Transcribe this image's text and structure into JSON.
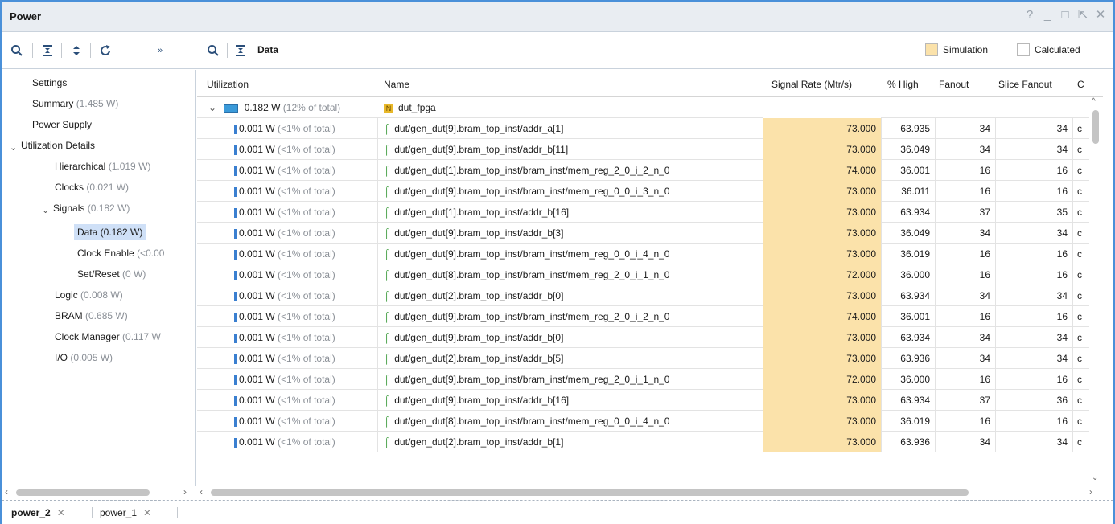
{
  "window": {
    "title": "Power",
    "controls": [
      "?",
      "_",
      "□",
      "⇱",
      "✕"
    ]
  },
  "toolbar": {
    "section_label": "Data",
    "legend": [
      {
        "label": "Simulation",
        "color": "#fbe2aa"
      },
      {
        "label": "Calculated",
        "color": "#ffffff"
      }
    ]
  },
  "tree": [
    {
      "label": "Settings",
      "value": ""
    },
    {
      "label": "Summary",
      "value": "(1.485 W)"
    },
    {
      "label": "Power Supply",
      "value": ""
    },
    {
      "label": "Utilization Details",
      "value": ""
    },
    {
      "label": "Hierarchical",
      "value": "(1.019 W)"
    },
    {
      "label": "Clocks",
      "value": "(0.021 W)"
    },
    {
      "label": "Signals",
      "value": "(0.182 W)"
    },
    {
      "label": "Data (0.182 W)",
      "value": ""
    },
    {
      "label": "Clock Enable",
      "value": "(<0.00"
    },
    {
      "label": "Set/Reset",
      "value": "(0 W)"
    },
    {
      "label": "Logic",
      "value": "(0.008 W)"
    },
    {
      "label": "BRAM",
      "value": "(0.685 W)"
    },
    {
      "label": "Clock Manager",
      "value": "(0.117 W"
    },
    {
      "label": "I/O",
      "value": "(0.005 W)"
    }
  ],
  "columns": [
    "Utilization",
    "Name",
    "Signal Rate (Mtr/s)",
    "% High",
    "Fanout",
    "Slice Fanout",
    "C"
  ],
  "top_row": {
    "util_value": "0.182 W",
    "util_note": "(12% of total)",
    "name": "dut_fpga"
  },
  "rows": [
    {
      "w": "0.001 W",
      "pct": "(<1% of total)",
      "name": "dut/gen_dut[9].bram_top_inst/addr_a[1]",
      "rate": "73.000",
      "high": "63.935",
      "fanout": "34",
      "slice": "34",
      "c": "c"
    },
    {
      "w": "0.001 W",
      "pct": "(<1% of total)",
      "name": "dut/gen_dut[9].bram_top_inst/addr_b[11]",
      "rate": "73.000",
      "high": "36.049",
      "fanout": "34",
      "slice": "34",
      "c": "c"
    },
    {
      "w": "0.001 W",
      "pct": "(<1% of total)",
      "name": "dut/gen_dut[1].bram_top_inst/bram_inst/mem_reg_2_0_i_2_n_0",
      "rate": "74.000",
      "high": "36.001",
      "fanout": "16",
      "slice": "16",
      "c": "c"
    },
    {
      "w": "0.001 W",
      "pct": "(<1% of total)",
      "name": "dut/gen_dut[9].bram_top_inst/bram_inst/mem_reg_0_0_i_3_n_0",
      "rate": "73.000",
      "high": "36.011",
      "fanout": "16",
      "slice": "16",
      "c": "c"
    },
    {
      "w": "0.001 W",
      "pct": "(<1% of total)",
      "name": "dut/gen_dut[1].bram_top_inst/addr_b[16]",
      "rate": "73.000",
      "high": "63.934",
      "fanout": "37",
      "slice": "35",
      "c": "c"
    },
    {
      "w": "0.001 W",
      "pct": "(<1% of total)",
      "name": "dut/gen_dut[9].bram_top_inst/addr_b[3]",
      "rate": "73.000",
      "high": "36.049",
      "fanout": "34",
      "slice": "34",
      "c": "c"
    },
    {
      "w": "0.001 W",
      "pct": "(<1% of total)",
      "name": "dut/gen_dut[9].bram_top_inst/bram_inst/mem_reg_0_0_i_4_n_0",
      "rate": "73.000",
      "high": "36.019",
      "fanout": "16",
      "slice": "16",
      "c": "c"
    },
    {
      "w": "0.001 W",
      "pct": "(<1% of total)",
      "name": "dut/gen_dut[8].bram_top_inst/bram_inst/mem_reg_2_0_i_1_n_0",
      "rate": "72.000",
      "high": "36.000",
      "fanout": "16",
      "slice": "16",
      "c": "c"
    },
    {
      "w": "0.001 W",
      "pct": "(<1% of total)",
      "name": "dut/gen_dut[2].bram_top_inst/addr_b[0]",
      "rate": "73.000",
      "high": "63.934",
      "fanout": "34",
      "slice": "34",
      "c": "c"
    },
    {
      "w": "0.001 W",
      "pct": "(<1% of total)",
      "name": "dut/gen_dut[9].bram_top_inst/bram_inst/mem_reg_2_0_i_2_n_0",
      "rate": "74.000",
      "high": "36.001",
      "fanout": "16",
      "slice": "16",
      "c": "c"
    },
    {
      "w": "0.001 W",
      "pct": "(<1% of total)",
      "name": "dut/gen_dut[9].bram_top_inst/addr_b[0]",
      "rate": "73.000",
      "high": "63.934",
      "fanout": "34",
      "slice": "34",
      "c": "c"
    },
    {
      "w": "0.001 W",
      "pct": "(<1% of total)",
      "name": "dut/gen_dut[2].bram_top_inst/addr_b[5]",
      "rate": "73.000",
      "high": "63.936",
      "fanout": "34",
      "slice": "34",
      "c": "c"
    },
    {
      "w": "0.001 W",
      "pct": "(<1% of total)",
      "name": "dut/gen_dut[9].bram_top_inst/bram_inst/mem_reg_2_0_i_1_n_0",
      "rate": "72.000",
      "high": "36.000",
      "fanout": "16",
      "slice": "16",
      "c": "c"
    },
    {
      "w": "0.001 W",
      "pct": "(<1% of total)",
      "name": "dut/gen_dut[9].bram_top_inst/addr_b[16]",
      "rate": "73.000",
      "high": "63.934",
      "fanout": "37",
      "slice": "36",
      "c": "c"
    },
    {
      "w": "0.001 W",
      "pct": "(<1% of total)",
      "name": "dut/gen_dut[8].bram_top_inst/bram_inst/mem_reg_0_0_i_4_n_0",
      "rate": "73.000",
      "high": "36.019",
      "fanout": "16",
      "slice": "16",
      "c": "c"
    },
    {
      "w": "0.001 W",
      "pct": "(<1% of total)",
      "name": "dut/gen_dut[2].bram_top_inst/addr_b[1]",
      "rate": "73.000",
      "high": "63.936",
      "fanout": "34",
      "slice": "34",
      "c": "c"
    }
  ],
  "tabs": [
    {
      "label": "power_2",
      "active": true
    },
    {
      "label": "power_1",
      "active": false
    }
  ]
}
